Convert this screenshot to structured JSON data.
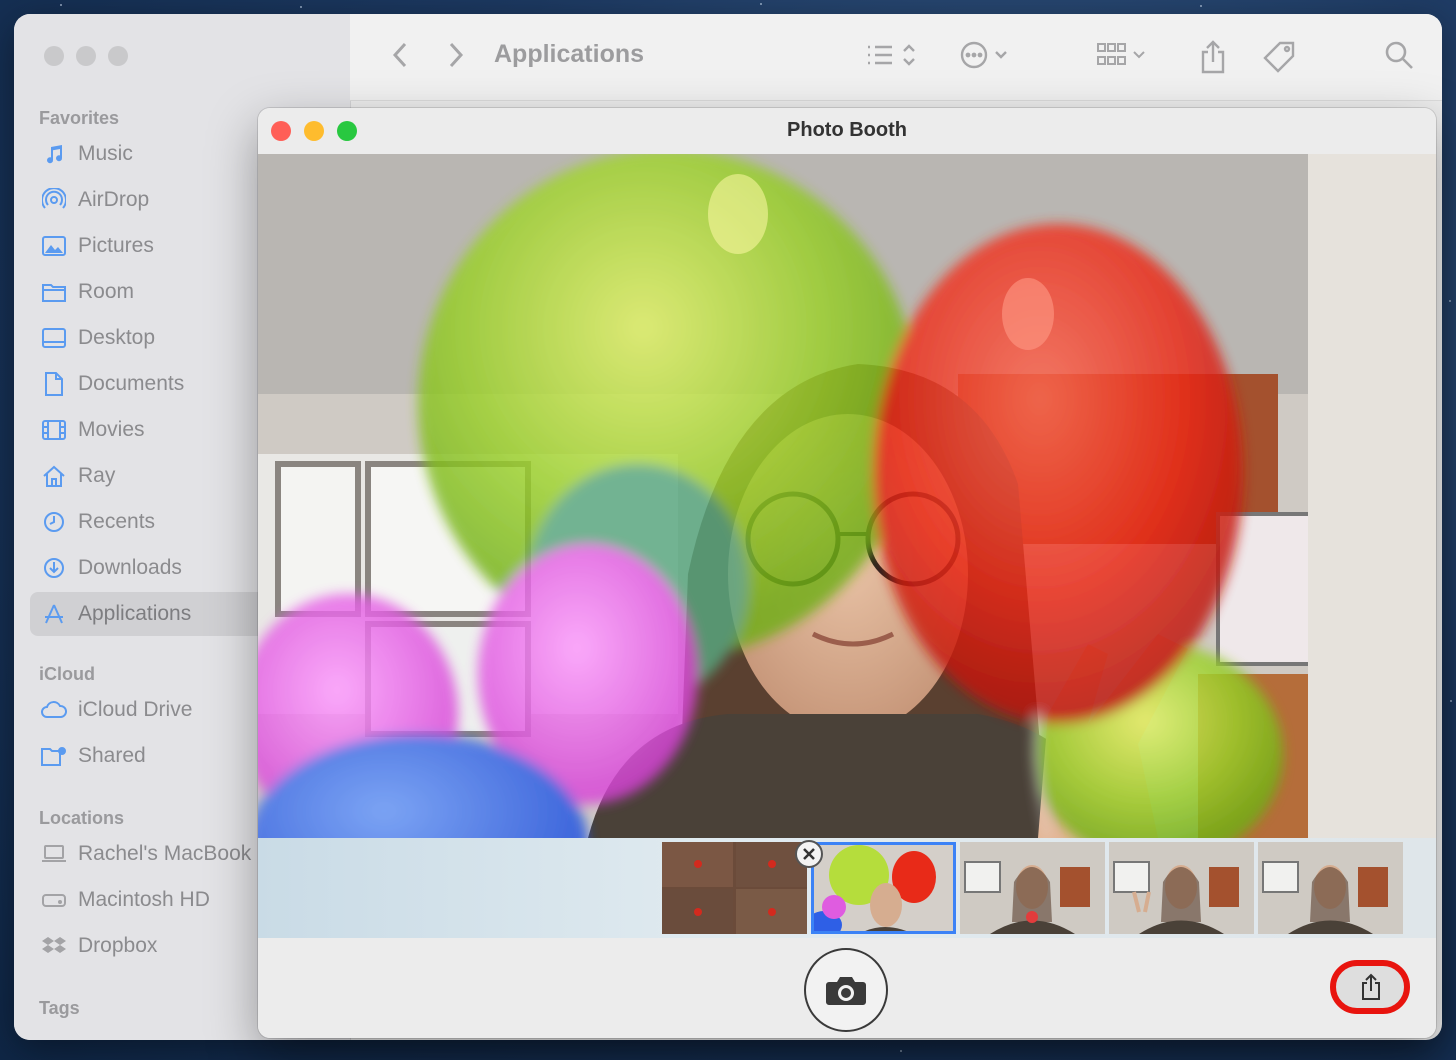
{
  "finder": {
    "toolbar_title": "Applications",
    "sidebar": {
      "favorites_heading": "Favorites",
      "favorites": [
        {
          "label": "Music",
          "icon": "music-note-icon"
        },
        {
          "label": "AirDrop",
          "icon": "airdrop-icon"
        },
        {
          "label": "Pictures",
          "icon": "pictures-icon"
        },
        {
          "label": "Room",
          "icon": "folder-icon"
        },
        {
          "label": "Desktop",
          "icon": "desktop-icon"
        },
        {
          "label": "Documents",
          "icon": "document-icon"
        },
        {
          "label": "Movies",
          "icon": "film-icon"
        },
        {
          "label": "Ray",
          "icon": "home-icon"
        },
        {
          "label": "Recents",
          "icon": "clock-icon"
        },
        {
          "label": "Downloads",
          "icon": "download-icon"
        },
        {
          "label": "Applications",
          "icon": "applications-icon",
          "selected": true
        }
      ],
      "icloud_heading": "iCloud",
      "icloud": [
        {
          "label": "iCloud Drive",
          "icon": "cloud-icon"
        },
        {
          "label": "Shared",
          "icon": "shared-folder-icon"
        }
      ],
      "locations_heading": "Locations",
      "locations": [
        {
          "label": "Rachel's MacBook",
          "icon": "laptop-icon"
        },
        {
          "label": "Macintosh HD",
          "icon": "disk-icon"
        },
        {
          "label": "Dropbox",
          "icon": "dropbox-icon"
        }
      ],
      "tags_heading": "Tags"
    }
  },
  "photo_booth": {
    "title": "Photo Booth",
    "thumbnail_count": 5,
    "selected_thumbnail": 2,
    "share_highlight_color": "#e8140e"
  },
  "colors": {
    "close": "#ff5f57",
    "minimize": "#febc2e",
    "zoom": "#28c840",
    "selection": "#3b82f6"
  }
}
